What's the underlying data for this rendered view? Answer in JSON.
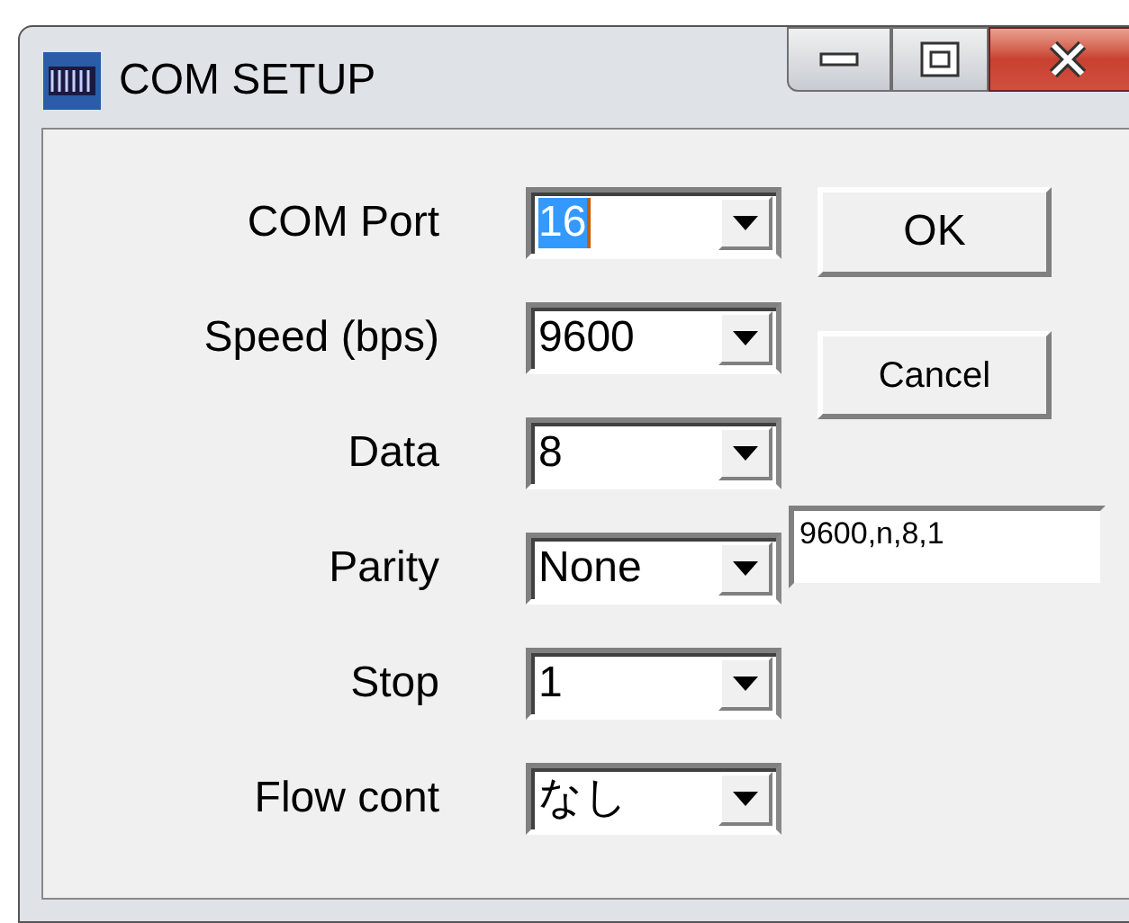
{
  "window": {
    "title": "COM SETUP"
  },
  "fields": [
    {
      "label": "COM Port",
      "value": "16",
      "focused": true
    },
    {
      "label": "Speed (bps)",
      "value": "9600",
      "focused": false
    },
    {
      "label": "Data",
      "value": "8",
      "focused": false
    },
    {
      "label": "Parity",
      "value": "None",
      "focused": false
    },
    {
      "label": "Stop",
      "value": "1",
      "focused": false
    },
    {
      "label": "Flow cont",
      "value": "なし",
      "focused": false
    }
  ],
  "buttons": [
    "OK",
    "Cancel"
  ],
  "summary": {
    "value": "9600,n,8,1"
  }
}
